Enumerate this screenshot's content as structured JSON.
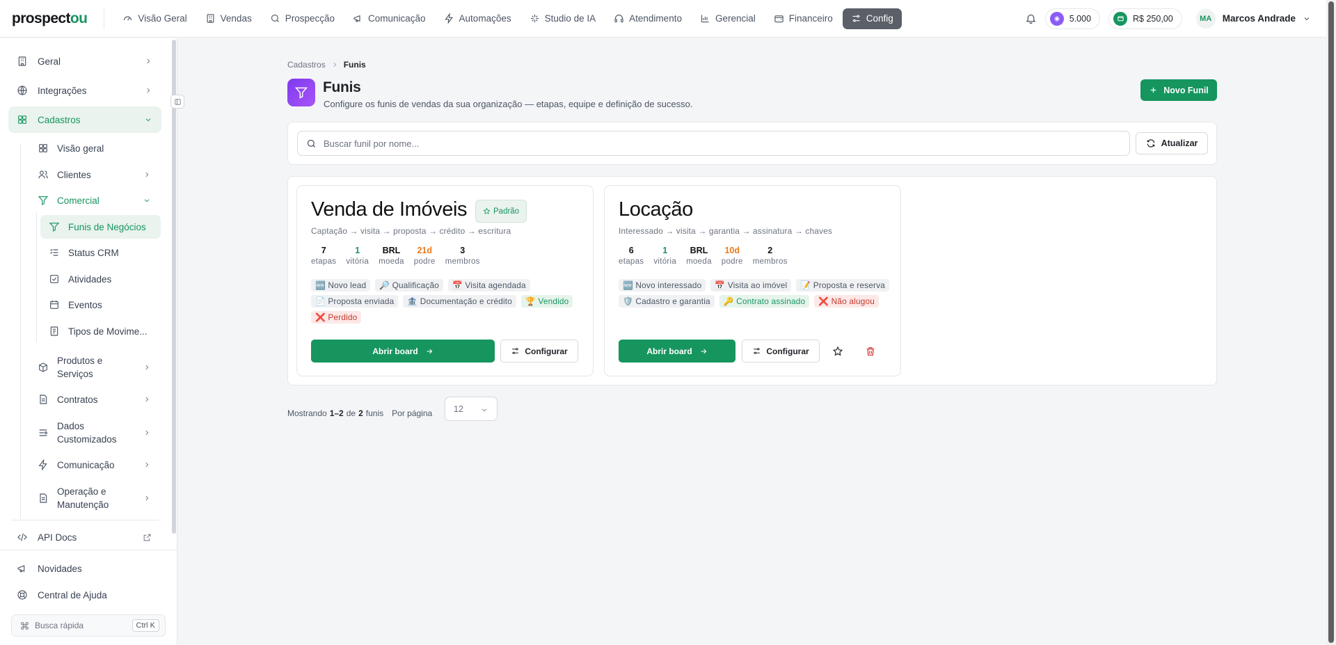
{
  "brand": {
    "logo_main": "prospect",
    "logo_accent": "ou"
  },
  "topnav": [
    {
      "label": "Visão Geral",
      "icon": "gauge-icon"
    },
    {
      "label": "Vendas",
      "icon": "building-icon"
    },
    {
      "label": "Prospecção",
      "icon": "search-icon"
    },
    {
      "label": "Comunicação",
      "icon": "megaphone-icon"
    },
    {
      "label": "Automações",
      "icon": "bolt-icon"
    },
    {
      "label": "Studio de IA",
      "icon": "sparkle-icon"
    },
    {
      "label": "Atendimento",
      "icon": "headset-icon"
    },
    {
      "label": "Gerencial",
      "icon": "bar-chart-icon"
    },
    {
      "label": "Financeiro",
      "icon": "wallet-icon"
    },
    {
      "label": "Config",
      "icon": "sliders-icon",
      "active": true
    }
  ],
  "header": {
    "credits": "5.000",
    "balance": "R$ 250,00",
    "user_initials": "MA",
    "user_name": "Marcos Andrade"
  },
  "sidebar": {
    "geral": "Geral",
    "integracoes": "Integrações",
    "cadastros": "Cadastros",
    "visao_geral": "Visão geral",
    "clientes": "Clientes",
    "comercial": "Comercial",
    "funis": "Funis de Negócios",
    "status_crm": "Status CRM",
    "atividades": "Atividades",
    "eventos": "Eventos",
    "tipos_mov": "Tipos de Movime...",
    "produtos_1": "Produtos e",
    "produtos_2": "Serviços",
    "contratos": "Contratos",
    "dados_1": "Dados",
    "dados_2": "Customizados",
    "comunicacao": "Comunicação",
    "operacao_1": "Operação e",
    "operacao_2": "Manutenção",
    "api_docs": "API Docs",
    "novidades": "Novidades",
    "ajuda": "Central de Ajuda",
    "busca_rapida": "Busca rápida",
    "busca_kbd": "Ctrl K"
  },
  "breadcrumb": {
    "parent": "Cadastros",
    "current": "Funis"
  },
  "page": {
    "title": "Funis",
    "subtitle": "Configure os funis de vendas da sua organização — etapas, equipe e definição de sucesso.",
    "new_button": "Novo Funil",
    "search_placeholder": "Buscar funil por nome...",
    "refresh_button": "Atualizar"
  },
  "funnels": [
    {
      "name": "Venda de Imóveis",
      "badge": "Padrão",
      "flow": "Captação → visita → proposta → crédito → escritura",
      "stats": [
        {
          "value": "7",
          "label": "etapas"
        },
        {
          "value": "1",
          "label": "vitória"
        },
        {
          "value": "BRL",
          "label": "moeda"
        },
        {
          "value": "21d",
          "label": "podre"
        },
        {
          "value": "3",
          "label": "membros"
        }
      ],
      "stages": [
        "🆕 Novo lead",
        "🔎 Qualificação",
        "📅 Visita agendada",
        "📄 Proposta enviada",
        "🏦 Documentação e crédito",
        "🏆 Vendido",
        "❌ Perdido"
      ],
      "open_label": "Abrir board",
      "config_label": "Configurar"
    },
    {
      "name": "Locação",
      "flow": "Interessado → visita → garantia → assinatura → chaves",
      "stats": [
        {
          "value": "6",
          "label": "etapas"
        },
        {
          "value": "1",
          "label": "vitória"
        },
        {
          "value": "BRL",
          "label": "moeda"
        },
        {
          "value": "10d",
          "label": "podre"
        },
        {
          "value": "2",
          "label": "membros"
        }
      ],
      "stages": [
        "🆕 Novo interessado",
        "📅 Visita ao imóvel",
        "📝 Proposta e reserva",
        "🛡️ Cadastro e garantia",
        "🔑 Contrato assinado",
        "❌ Não alugou"
      ],
      "open_label": "Abrir board",
      "config_label": "Configurar"
    }
  ],
  "pagination": {
    "prefix": "Mostrando",
    "range": "1–2",
    "of": "de",
    "total": "2",
    "unit": "funis",
    "per_page_label": "Por página",
    "per_page": "12"
  },
  "colors": {
    "brand_green": "#16955f",
    "purple": "#7c3aed",
    "orange": "#ea7a1c",
    "red": "#c0392b"
  }
}
